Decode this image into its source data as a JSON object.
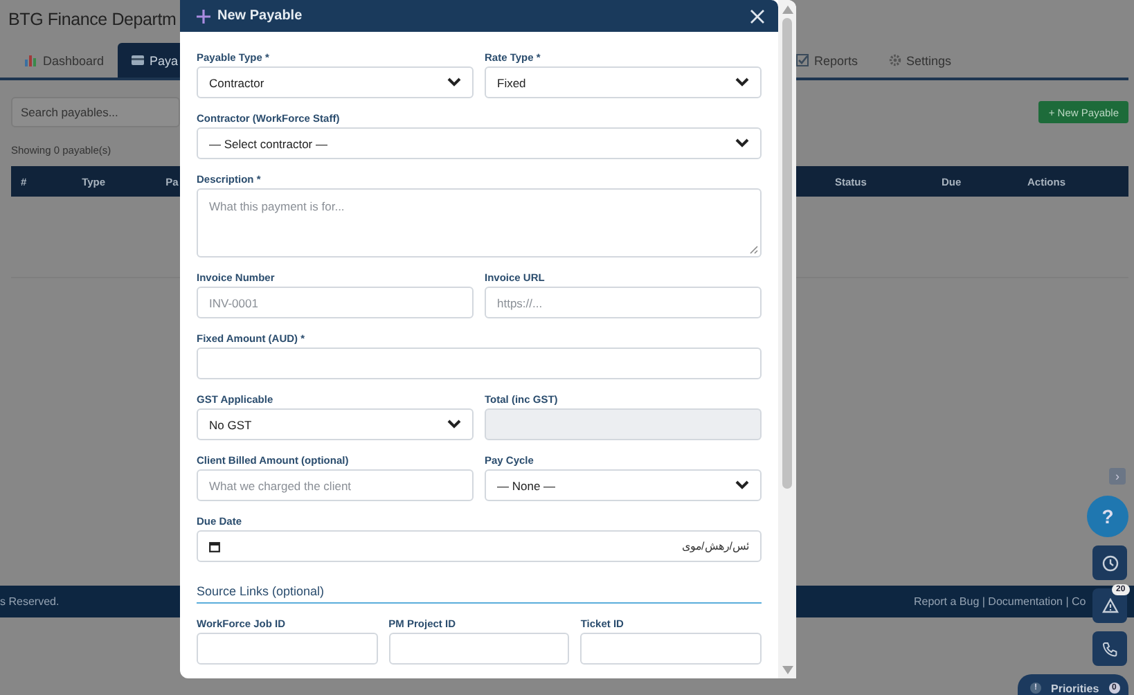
{
  "page": {
    "title": "BTG Finance Departm"
  },
  "tabs": [
    {
      "label": "Dashboard",
      "kind": "chart",
      "selected": false
    },
    {
      "label": "Paya",
      "kind": "card",
      "selected": true
    },
    {
      "label": "Reports",
      "kind": "check",
      "selected": false
    },
    {
      "label": "Settings",
      "kind": "gear",
      "selected": false
    }
  ],
  "search": {
    "placeholder": "Search payables..."
  },
  "new_button": "+ New Payable",
  "count_text": "Showing 0 payable(s)",
  "table": {
    "columns": [
      "#",
      "Type",
      "Pa",
      "Status",
      "Due",
      "Actions"
    ]
  },
  "footer": {
    "copyright": "s Reserved.",
    "links": "Report a Bug | Documentation | Co"
  },
  "floating": {
    "collapse": "›",
    "help": "?",
    "alerts_badge": "20",
    "priorities": {
      "icon": "!",
      "label": "Priorities",
      "count": "0"
    }
  },
  "modal": {
    "title": "New Payable",
    "rows": [
      [
        {
          "label": "Payable Type *",
          "kind": "select",
          "value": "Contractor"
        },
        {
          "label": "Rate Type *",
          "kind": "select",
          "value": "Fixed"
        }
      ],
      [
        {
          "label": "Contractor (WorkForce Staff)",
          "kind": "select",
          "value": "— Select contractor —"
        }
      ],
      [
        {
          "label": "Description *",
          "kind": "textarea",
          "placeholder": "What this payment is for..."
        }
      ],
      [
        {
          "label": "Invoice Number",
          "kind": "input",
          "placeholder": "INV-0001"
        },
        {
          "label": "Invoice URL",
          "kind": "input",
          "placeholder": "https://..."
        }
      ],
      [
        {
          "label": "Fixed Amount (AUD) *",
          "kind": "input"
        }
      ],
      [
        {
          "label": "GST Applicable",
          "kind": "select",
          "value": "No GST"
        },
        {
          "label": "Total (inc GST)",
          "kind": "readonly"
        }
      ],
      [
        {
          "label": "Client Billed Amount (optional)",
          "kind": "input",
          "placeholder": "What we charged the client"
        },
        {
          "label": "Pay Cycle",
          "kind": "select",
          "value": "— None —"
        }
      ],
      [
        {
          "label": "Due Date",
          "kind": "date",
          "placeholder": "ئس/رهش/موی"
        }
      ]
    ],
    "section": "Source Links (optional)",
    "link_fields": [
      {
        "label": "WorkForce Job ID",
        "kind": "input"
      },
      {
        "label": "PM Project ID",
        "kind": "input"
      },
      {
        "label": "Ticket ID",
        "kind": "input"
      }
    ]
  }
}
